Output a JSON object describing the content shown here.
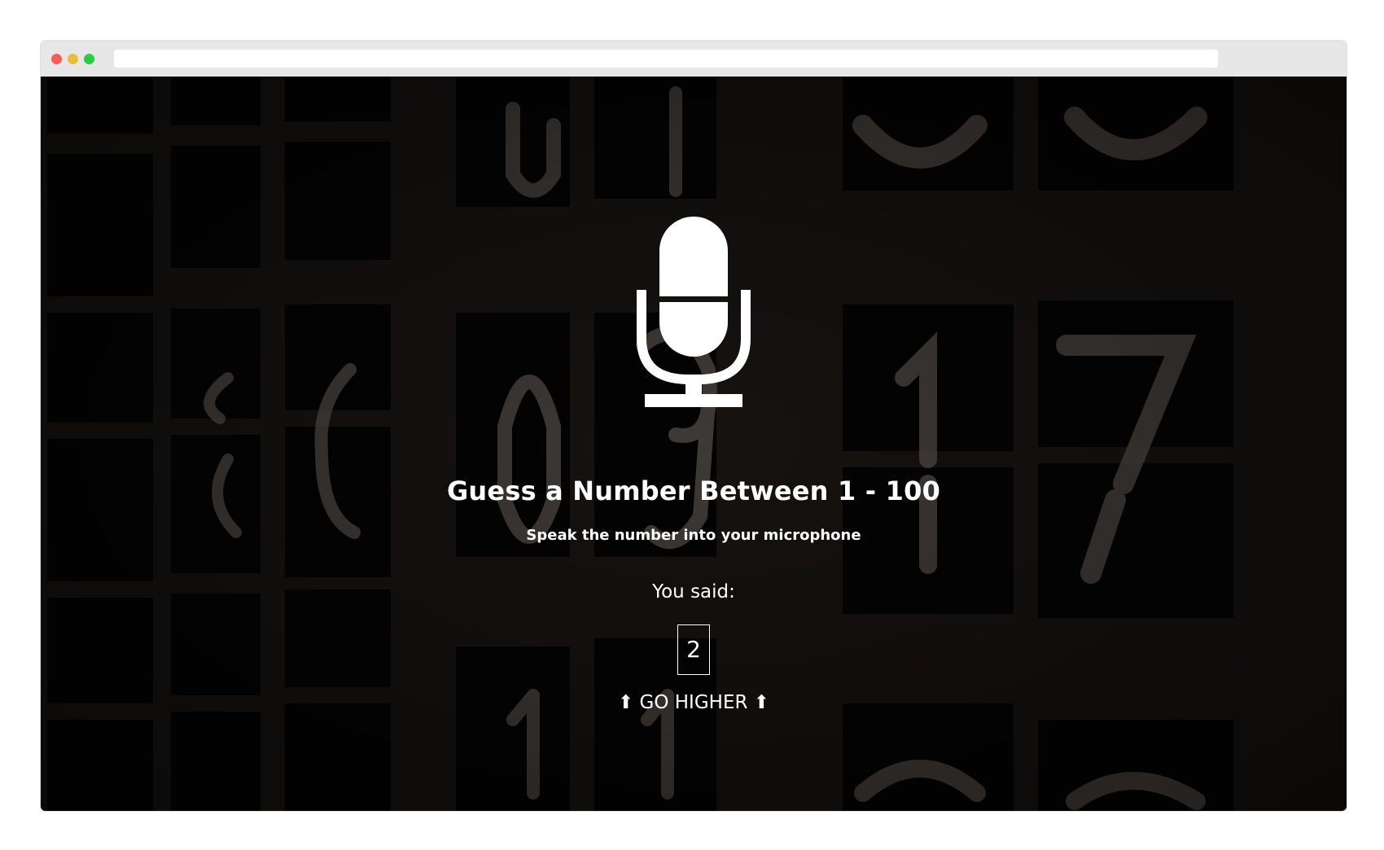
{
  "game": {
    "title": "Guess a Number Between 1 - 100",
    "subtitle": "Speak the number into your microphone",
    "you_said_label": "You said:",
    "guess": "2",
    "hint": "⬆ GO HIGHER ⬆",
    "icon": "microphone-icon"
  },
  "colors": {
    "background": "#141211",
    "text": "#ffffff"
  }
}
